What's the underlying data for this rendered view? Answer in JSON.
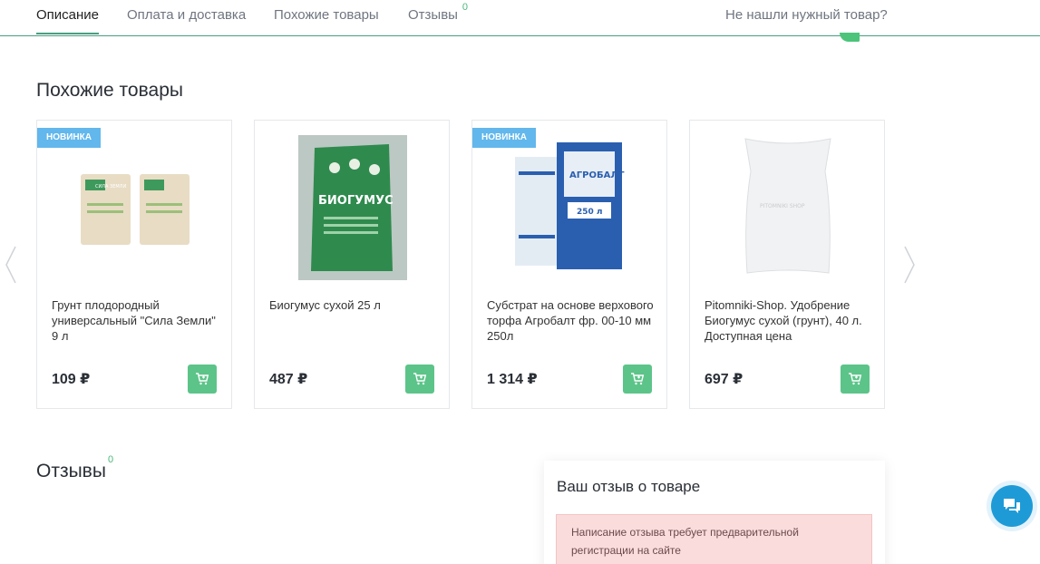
{
  "tabs": [
    {
      "label": "Описание"
    },
    {
      "label": "Оплата и доставка"
    },
    {
      "label": "Похожие товары"
    },
    {
      "label": "Отзывы",
      "count": "0"
    }
  ],
  "help_link": "Не нашли нужный товар?",
  "similar": {
    "title": "Похожие товары",
    "products": [
      {
        "badge": "НОВИНКА",
        "image_text": "СИЛА ЗЕМЛИ",
        "title": "Грунт плодородный универсальный \"Сила Земли\" 9 л",
        "price": "109 ₽"
      },
      {
        "badge": "",
        "image_text": "БИОГУМУС",
        "title": "Биогумус сухой 25 л",
        "price": "487 ₽"
      },
      {
        "badge": "НОВИНКА",
        "image_text": "АГРОБАЛТ",
        "image_text_2": "250 л",
        "title": "Субстрат на основе верхового торфа Агробалт фр. 00-10 мм 250л",
        "price": "1 314 ₽"
      },
      {
        "badge": "",
        "image_text": "PITOMNIKI SHOP",
        "title": "Pitomniki-Shop. Удобрение Биогумус сухой (грунт), 40 л. Доступная цена",
        "price": "697 ₽"
      }
    ]
  },
  "reviews": {
    "title": "Отзывы",
    "count": "0",
    "form_title": "Ваш отзыв о товаре",
    "alert": "Написание отзыва требует предварительной регистрации на сайте"
  },
  "colors": {
    "accent": "#4a9e82",
    "cart": "#5cc489",
    "badge": "#62b7ec",
    "chat": "#1e9bd7"
  }
}
